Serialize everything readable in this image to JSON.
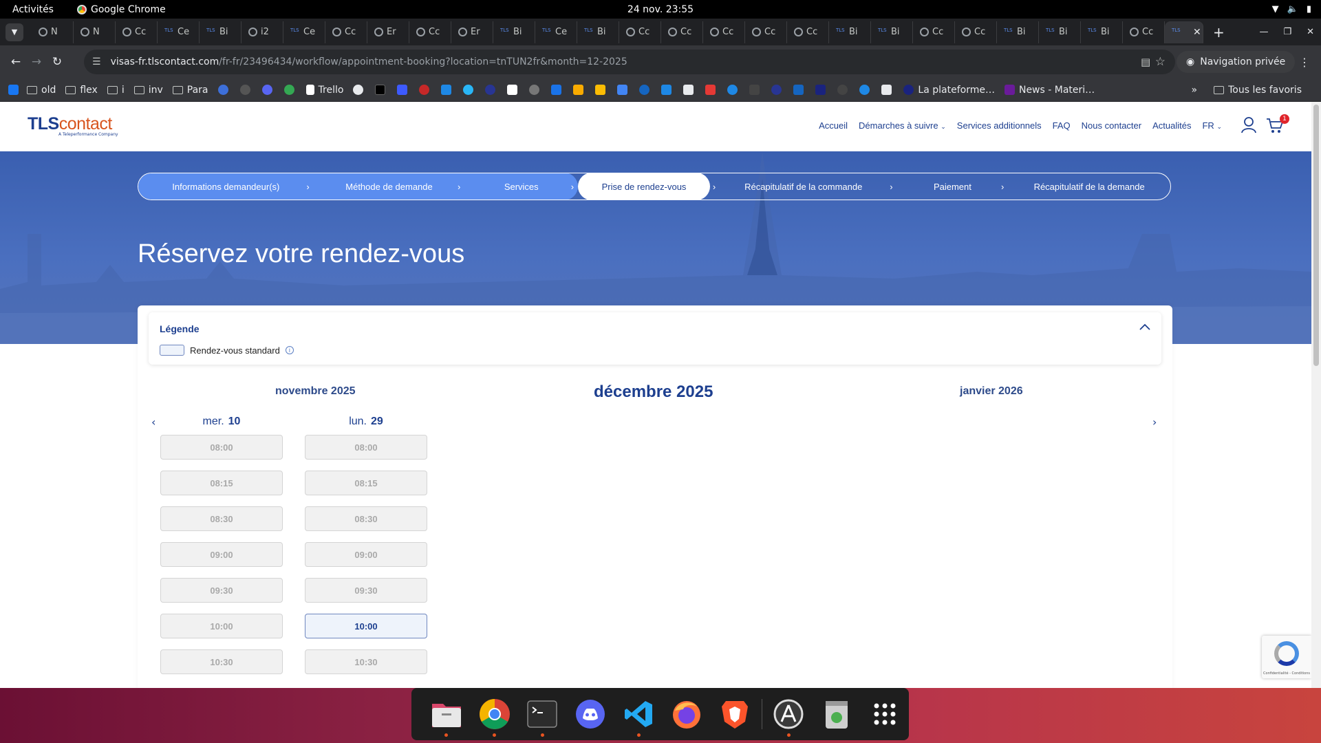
{
  "system": {
    "activities": "Activités",
    "app_name": "Google Chrome",
    "clock": "24 nov.  23:55"
  },
  "tabs": [
    {
      "label": "N",
      "icon": "incognito-icon"
    },
    {
      "label": "N",
      "icon": "incognito-icon"
    },
    {
      "label": "Cc",
      "icon": "globe-icon"
    },
    {
      "label": "Ce",
      "icon": "tls-icon"
    },
    {
      "label": "Bi",
      "icon": "tls-icon"
    },
    {
      "label": "i2",
      "icon": "globe-icon"
    },
    {
      "label": "Ce",
      "icon": "tls-icon"
    },
    {
      "label": "Cc",
      "icon": "globe-icon"
    },
    {
      "label": "Er",
      "icon": "globe-icon"
    },
    {
      "label": "Cc",
      "icon": "globe-icon"
    },
    {
      "label": "Er",
      "icon": "globe-icon"
    },
    {
      "label": "Bi",
      "icon": "tls-icon"
    },
    {
      "label": "Ce",
      "icon": "tls-icon"
    },
    {
      "label": "Bi",
      "icon": "tls-icon"
    },
    {
      "label": "Cc",
      "icon": "globe-icon"
    },
    {
      "label": "Cc",
      "icon": "globe-icon"
    },
    {
      "label": "Cc",
      "icon": "globe-icon"
    },
    {
      "label": "Cc",
      "icon": "globe-icon"
    },
    {
      "label": "Cc",
      "icon": "globe-icon"
    },
    {
      "label": "Bi",
      "icon": "tls-icon"
    },
    {
      "label": "Bi",
      "icon": "tls-icon"
    },
    {
      "label": "Cc",
      "icon": "globe-icon"
    },
    {
      "label": "Cc",
      "icon": "globe-icon"
    },
    {
      "label": "Bi",
      "icon": "tls-icon"
    },
    {
      "label": "Bi",
      "icon": "tls-icon"
    },
    {
      "label": "Bi",
      "icon": "tls-icon"
    },
    {
      "label": "Cc",
      "icon": "globe-icon"
    }
  ],
  "address_bar": {
    "host": "visas-fr.tlscontact.com",
    "path": "/fr-fr/23496434/workflow/appointment-booking?location=tnTUN2fr&month=12-2025",
    "incognito_label": "Navigation privée"
  },
  "bookmarks": {
    "folders": [
      "old",
      "flex",
      "i",
      "inv",
      "Para"
    ],
    "trello": "Trello",
    "plateforme": "La plateforme…",
    "news": "News - Materi…",
    "all_bookmarks": "Tous les favoris"
  },
  "site": {
    "logo_main": "TLS",
    "logo_accent": "contact",
    "logo_sub": "A Teleperformance Company",
    "nav": [
      "Accueil",
      "Démarches à suivre",
      "Services additionnels",
      "FAQ",
      "Nous contacter",
      "Actualités",
      "FR"
    ],
    "cart_count": "1"
  },
  "steps": [
    {
      "label": "Informations demandeur(s)",
      "state": "done"
    },
    {
      "label": "Méthode de demande",
      "state": "done"
    },
    {
      "label": "Services",
      "state": "done"
    },
    {
      "label": "Prise de rendez-vous",
      "state": "current"
    },
    {
      "label": "Récapitulatif de la commande",
      "state": "todo"
    },
    {
      "label": "Paiement",
      "state": "todo"
    },
    {
      "label": "Récapitulatif de la demande",
      "state": "todo"
    }
  ],
  "hero_title": "Réservez votre rendez-vous",
  "legend": {
    "title": "Légende",
    "item_label": "Rendez-vous standard"
  },
  "months": {
    "prev": "novembre 2025",
    "current": "décembre 2025",
    "next": "janvier 2026"
  },
  "days": [
    {
      "weekday": "mer.",
      "day": "10",
      "slots": [
        {
          "time": "08:00",
          "available": false
        },
        {
          "time": "08:15",
          "available": false
        },
        {
          "time": "08:30",
          "available": false
        },
        {
          "time": "09:00",
          "available": false
        },
        {
          "time": "09:30",
          "available": false
        },
        {
          "time": "10:00",
          "available": false
        },
        {
          "time": "10:30",
          "available": false
        }
      ]
    },
    {
      "weekday": "lun.",
      "day": "29",
      "slots": [
        {
          "time": "08:00",
          "available": false
        },
        {
          "time": "08:15",
          "available": false
        },
        {
          "time": "08:30",
          "available": false
        },
        {
          "time": "09:00",
          "available": false
        },
        {
          "time": "09:30",
          "available": false
        },
        {
          "time": "10:00",
          "available": true
        },
        {
          "time": "10:30",
          "available": false
        }
      ]
    }
  ],
  "recaptcha_text": "Confidentialité - Conditions",
  "colors": {
    "brand_blue": "#1d3f8f",
    "brand_orange": "#d8541e",
    "step_done": "#5b8def",
    "slot_available_border": "#6f87bf"
  }
}
